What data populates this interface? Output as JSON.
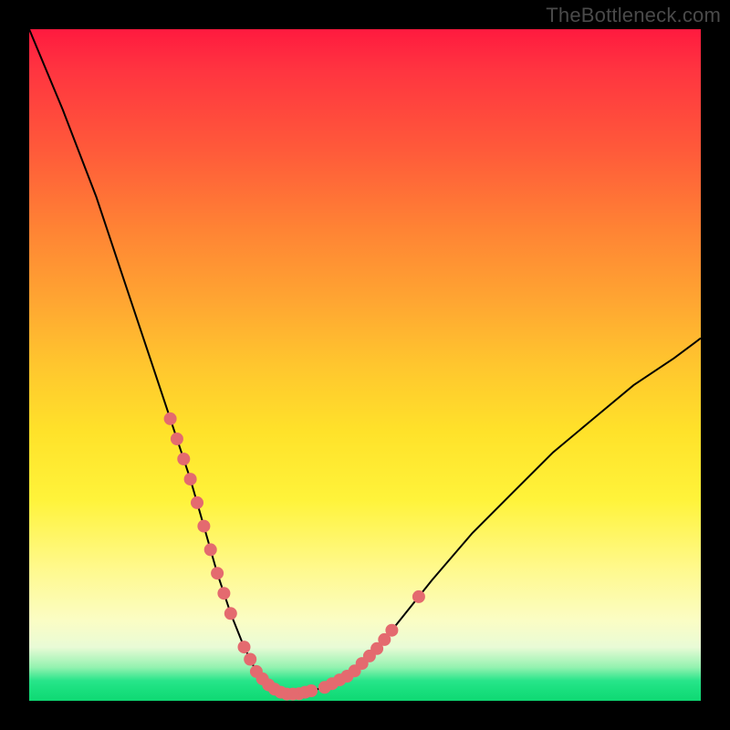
{
  "watermark": "TheBottleneck.com",
  "colors": {
    "frame": "#000000",
    "gradient_top": "#ff1a3f",
    "gradient_bottom": "#0fd873",
    "curve": "#000000",
    "dots": "#e46a6f"
  },
  "chart_data": {
    "type": "line",
    "title": "",
    "xlabel": "",
    "ylabel": "",
    "xlim": [
      0,
      100
    ],
    "ylim": [
      0,
      100
    ],
    "grid": false,
    "legend": false,
    "series": [
      {
        "name": "bottleneck-curve",
        "x": [
          0,
          5,
          10,
          14,
          18,
          21,
          24,
          26,
          28,
          30,
          32,
          34,
          36,
          38,
          40,
          44,
          48,
          52,
          56,
          60,
          66,
          72,
          78,
          84,
          90,
          96,
          100
        ],
        "y": [
          100,
          88,
          75,
          63,
          51,
          42,
          33,
          26,
          19,
          13,
          8,
          4,
          2,
          1,
          1,
          2,
          4,
          8,
          13,
          18,
          25,
          31,
          37,
          42,
          47,
          51,
          54
        ]
      }
    ],
    "points_on_curve": [
      {
        "name": "left-cluster",
        "x_range": [
          21,
          30
        ],
        "count": 10
      },
      {
        "name": "valley-cluster",
        "x_range": [
          32,
          42
        ],
        "count": 12
      },
      {
        "name": "right-cluster",
        "x_range": [
          44,
          54
        ],
        "count": 10
      },
      {
        "name": "right-outlier",
        "x_range": [
          58,
          58
        ],
        "count": 1
      }
    ],
    "annotations": []
  }
}
